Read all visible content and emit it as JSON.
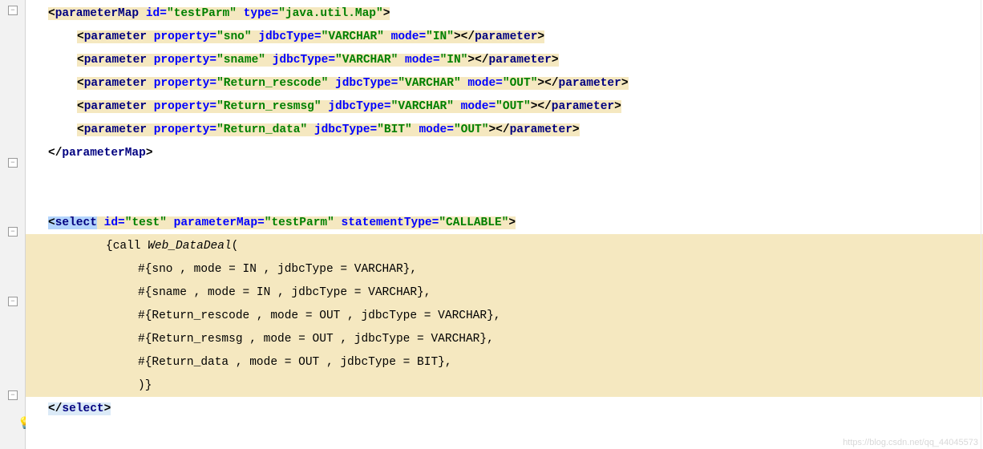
{
  "line1": {
    "tag_open": "<",
    "tag": "parameterMap",
    "attr1_name": "id",
    "attr1_val": "testParm",
    "attr2_name": "type",
    "attr2_val": "java.util.Map",
    "tag_close": ">"
  },
  "params": [
    {
      "tag": "parameter",
      "p_name": "property",
      "p_val": "sno",
      "j_name": "jdbcType",
      "j_val": "VARCHAR",
      "m_name": "mode",
      "m_val": "IN"
    },
    {
      "tag": "parameter",
      "p_name": "property",
      "p_val": "sname",
      "j_name": "jdbcType",
      "j_val": "VARCHAR",
      "m_name": "mode",
      "m_val": "IN"
    },
    {
      "tag": "parameter",
      "p_name": "property",
      "p_val": "Return_rescode",
      "j_name": "jdbcType",
      "j_val": "VARCHAR",
      "m_name": "mode",
      "m_val": "OUT"
    },
    {
      "tag": "parameter",
      "p_name": "property",
      "p_val": "Return_resmsg",
      "j_name": "jdbcType",
      "j_val": "VARCHAR",
      "m_name": "mode",
      "m_val": "OUT"
    },
    {
      "tag": "parameter",
      "p_name": "property",
      "p_val": "Return_data",
      "j_name": "jdbcType",
      "j_val": "BIT",
      "m_name": "mode",
      "m_val": "OUT"
    }
  ],
  "param_map_close": {
    "open": "</",
    "tag": "parameterMap",
    "close": ">"
  },
  "select_open": {
    "open": "<",
    "tag": "select",
    "a1n": "id",
    "a1v": "test",
    "a2n": "parameterMap",
    "a2v": "testParm",
    "a3n": "statementType",
    "a3v": "CALLABLE",
    "close": ">"
  },
  "call_lines": {
    "l1_open": "{call ",
    "l1_proc": "Web_DataDeal",
    "l1_paren": "(",
    "l2": "#{sno , mode = IN , jdbcType = VARCHAR},",
    "l3": "#{sname , mode = IN , jdbcType = VARCHAR},",
    "l4": "#{Return_rescode , mode = OUT , jdbcType = VARCHAR},",
    "l5": "#{Return_resmsg , mode = OUT , jdbcType = VARCHAR},",
    "l6": "#{Return_data , mode = OUT , jdbcType = BIT},",
    "l7": ")}"
  },
  "select_close": {
    "open": "</",
    "tag": "select",
    "close": ">"
  },
  "watermark": "https://blog.csdn.net/qq_44045573"
}
